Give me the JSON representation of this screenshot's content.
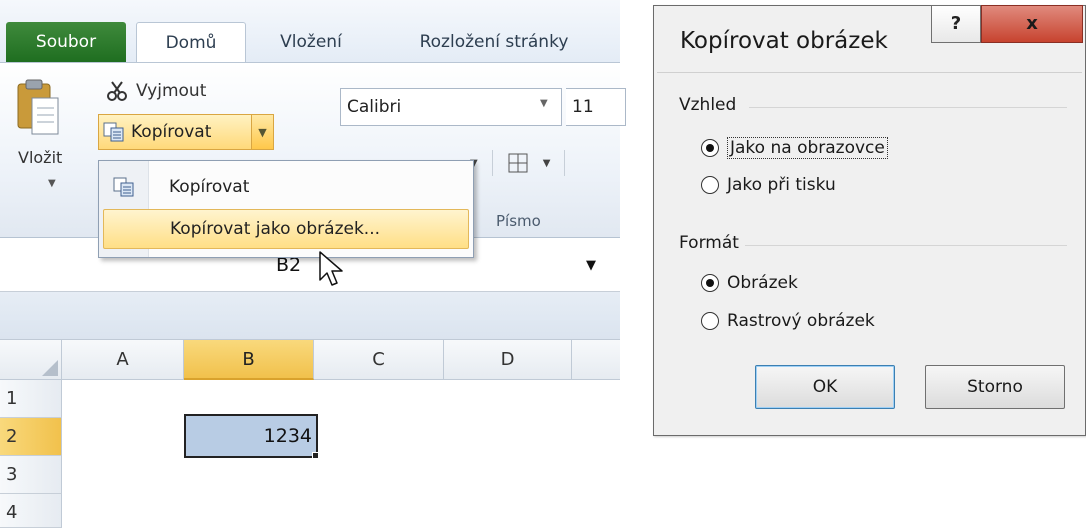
{
  "excel": {
    "tabs": {
      "file": "Soubor",
      "home": "Domů",
      "insert": "Vložení",
      "layout": "Rozložení stránky"
    },
    "clipboard": {
      "paste": "Vložit",
      "cut": "Vyjmout",
      "copy": "Kopírovat"
    },
    "font": {
      "name": "Calibri",
      "size": "11",
      "group_label": "Písmo"
    },
    "copy_menu": {
      "items": [
        "Kopírovat",
        "Kopírovat jako obrázek..."
      ]
    },
    "name_box": "B2",
    "grid": {
      "columns": [
        "A",
        "B",
        "C",
        "D"
      ],
      "rows": [
        "1",
        "2",
        "3",
        "4"
      ],
      "selected_column": "B",
      "selected_row": "2",
      "cell_value": "1234"
    }
  },
  "dialog": {
    "title": "Kopírovat obrázek",
    "help": "?",
    "close": "x",
    "appearance": {
      "label": "Vzhled",
      "options": [
        "Jako na obrazovce",
        "Jako při tisku"
      ],
      "selected": "Jako na obrazovce"
    },
    "format": {
      "label": "Formát",
      "options": [
        "Obrázek",
        "Rastrový obrázek"
      ],
      "selected": "Obrázek"
    },
    "ok": "OK",
    "cancel": "Storno"
  }
}
